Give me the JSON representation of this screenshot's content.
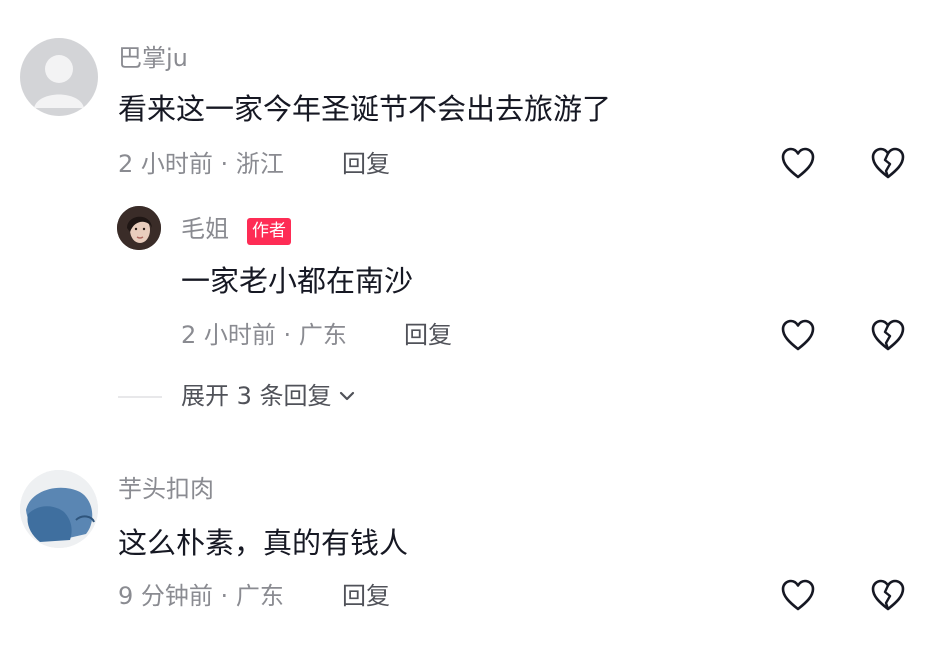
{
  "comments": [
    {
      "user": "巴掌ju",
      "text": "看来这一家今年圣诞节不会出去旅游了",
      "time": "2 小时前",
      "location": "浙江",
      "reply_label": "回复",
      "avatar": "default-gray",
      "replies": [
        {
          "user": "毛姐",
          "badge": "作者",
          "text": "一家老小都在南沙",
          "time": "2 小时前",
          "location": "广东",
          "reply_label": "回复",
          "avatar": "photo"
        }
      ],
      "expand_label": "展开 3 条回复"
    },
    {
      "user": "芋头扣肉",
      "text": "这么朴素，真的有钱人",
      "time": "9 分钟前",
      "location": "广东",
      "reply_label": "回复",
      "avatar": "blue-cartoon"
    }
  ],
  "separator": "·",
  "colors": {
    "primary_text": "#161823",
    "secondary_text": "#8a8b91",
    "badge_bg": "#fe2c55",
    "icon": "#161823"
  },
  "icons": {
    "like": "heart-icon",
    "dislike": "broken-heart-icon",
    "expand": "chevron-down-icon"
  }
}
